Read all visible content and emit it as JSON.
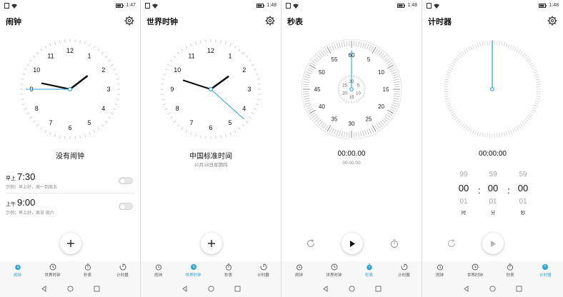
{
  "status": {
    "times": [
      "1:47",
      "1:48",
      "1:48",
      "1:48"
    ]
  },
  "titles": [
    "闹钟",
    "世界时钟",
    "秒表",
    "计时器"
  ],
  "clock_dial": [
    "12",
    "1",
    "2",
    "3",
    "4",
    "5",
    "6",
    "7",
    "8",
    "9",
    "10",
    "11"
  ],
  "alarm": {
    "empty_label": "没有闹钟",
    "items": [
      {
        "prefix": "早上",
        "time": "7:30",
        "note": "示例：早上好，周一到周五"
      },
      {
        "prefix": "上午",
        "time": "9:00",
        "note": "示例：早上好，周日 周六"
      }
    ]
  },
  "world": {
    "zone": "中国标准时间",
    "date": "10月18日星期四"
  },
  "stopwatch": {
    "outer_labels": [
      "60",
      "5",
      "10",
      "15",
      "20",
      "25",
      "30",
      "35",
      "40",
      "45",
      "50",
      "55"
    ],
    "inner_labels": [
      "30",
      "5",
      "10",
      "15",
      "20",
      "25"
    ],
    "time": "00:00.00",
    "sub_time": "00:00.00"
  },
  "timer": {
    "time": "00:00:00",
    "columns": [
      {
        "above": "99",
        "value": "00",
        "below": "01",
        "unit": "时"
      },
      {
        "above": "59",
        "value": "00",
        "below": "01",
        "unit": "分"
      },
      {
        "above": "59",
        "value": "00",
        "below": "01",
        "unit": "秒"
      }
    ]
  },
  "tabs": [
    "闹钟",
    "世界时钟",
    "秒表",
    "计时器"
  ],
  "colors": {
    "accent": "#2ba7d8",
    "hand": "#111111",
    "tick": "#c8c8c8"
  },
  "icons": {
    "settings": "gear-icon",
    "add": "plus-icon",
    "play": "play-icon",
    "reset": "refresh-icon",
    "lap": "stopwatch-icon"
  }
}
